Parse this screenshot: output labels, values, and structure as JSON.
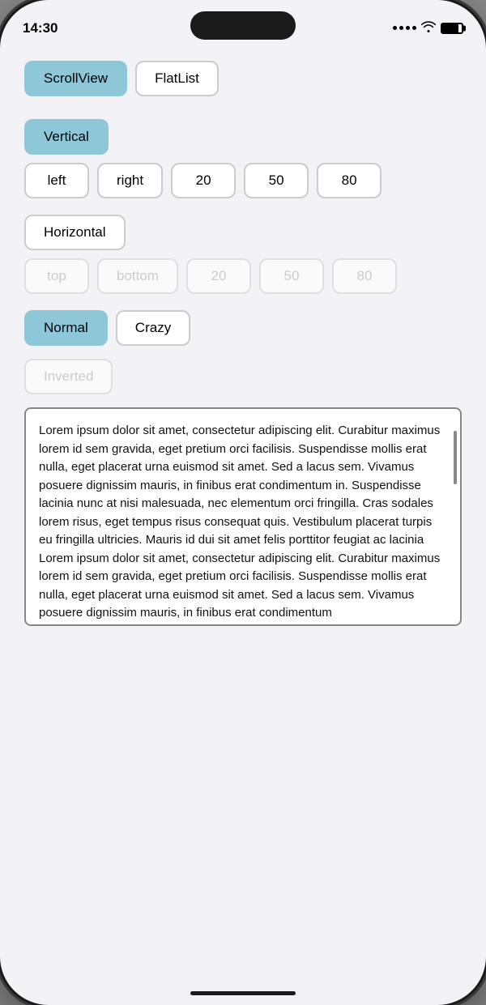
{
  "statusBar": {
    "time": "14:30"
  },
  "buttons": {
    "viewType": {
      "scrollView": "ScrollView",
      "flatList": "FlatList"
    },
    "vertical": {
      "label": "Vertical",
      "options": [
        "left",
        "right",
        "20",
        "50",
        "80"
      ]
    },
    "horizontal": {
      "label": "Horizontal",
      "options": [
        "top",
        "bottom",
        "20",
        "50",
        "80"
      ]
    },
    "normalCrazy": {
      "normal": "Normal",
      "crazy": "Crazy"
    },
    "inverted": "Inverted"
  },
  "textContent": "Lorem ipsum dolor sit amet, consectetur adipiscing elit. Curabitur maximus lorem id sem gravida, eget pretium orci facilisis. Suspendisse mollis erat nulla, eget placerat urna euismod sit amet. Sed a lacus sem. Vivamus posuere dignissim mauris, in finibus erat condimentum in. Suspendisse lacinia nunc at nisi malesuada, nec elementum orci fringilla. Cras sodales lorem risus, eget tempus risus consequat quis. Vestibulum placerat turpis eu fringilla ultricies. Mauris id dui sit amet felis porttitor feugiat ac lacinia Lorem ipsum dolor sit amet, consectetur adipiscing elit. Curabitur maximus lorem id sem gravida, eget pretium orci facilisis. Suspendisse mollis erat nulla, eget placerat urna euismod sit amet. Sed a lacus sem. Vivamus posuere dignissim mauris, in finibus erat condimentum"
}
